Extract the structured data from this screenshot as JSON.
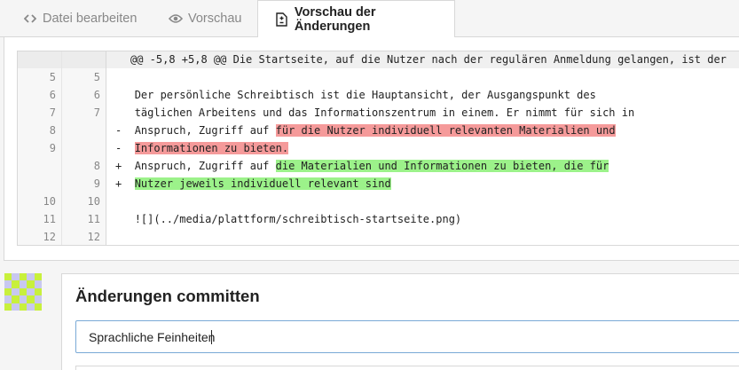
{
  "tabs": [
    {
      "label": "Datei bearbeiten",
      "icon": "code-icon"
    },
    {
      "label": "Vorschau",
      "icon": "eye-icon"
    },
    {
      "label": "Vorschau der Änderungen",
      "icon": "file-diff-icon",
      "active": true
    }
  ],
  "diff": {
    "hunk_header": "@@ -5,8 +5,8 @@ Die Startseite, auf die Nutzer nach der regulären Anmeldung gelangen, ist der",
    "lines": [
      {
        "old": "5",
        "new": "5",
        "marker": " ",
        "text": ""
      },
      {
        "old": "6",
        "new": "6",
        "marker": " ",
        "text": "Der persönliche Schreibtisch ist die Hauptansicht, der Ausgangspunkt des"
      },
      {
        "old": "7",
        "new": "7",
        "marker": " ",
        "text": "täglichen Arbeitens und das Informationszentrum in einem. Er nimmt für sich in"
      },
      {
        "old": "8",
        "new": "",
        "marker": "-",
        "text": "Anspruch, Zugriff auf ",
        "highlight": "für die Nutzer individuell relevanten Materialien und"
      },
      {
        "old": "9",
        "new": "",
        "marker": "-",
        "text": "",
        "highlight": "Informationen zu bieten."
      },
      {
        "old": "",
        "new": "8",
        "marker": "+",
        "text": "Anspruch, Zugriff auf ",
        "highlight": "die Materialien und Informationen zu bieten, die für"
      },
      {
        "old": "",
        "new": "9",
        "marker": "+",
        "text": "",
        "highlight": "Nutzer jeweils individuell relevant sind"
      },
      {
        "old": "10",
        "new": "10",
        "marker": " ",
        "text": ""
      },
      {
        "old": "11",
        "new": "11",
        "marker": " ",
        "text": "![](../media/plattform/schreibtisch-startseite.png)"
      },
      {
        "old": "12",
        "new": "12",
        "marker": " ",
        "text": ""
      }
    ]
  },
  "commit": {
    "title": "Änderungen committen",
    "message_value": "Sprachliche Feinheiten"
  },
  "colors": {
    "deleted_highlight": "#f59a9a",
    "added_highlight": "#9cf28a",
    "avatar_primary": "#c8f03c",
    "avatar_secondary": "#c8c8f0"
  }
}
